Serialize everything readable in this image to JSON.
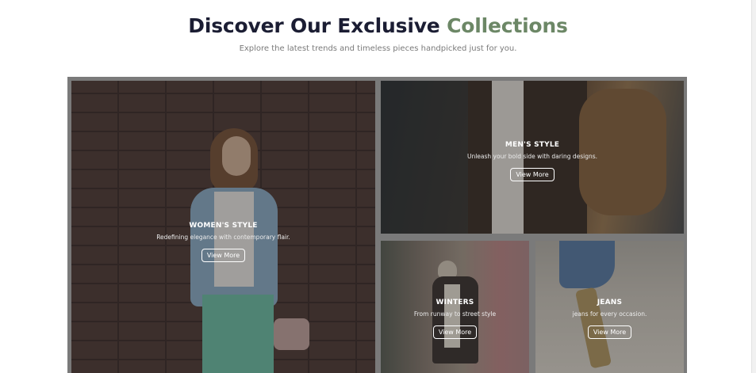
{
  "header": {
    "title_main": "Discover Our Exclusive",
    "title_accent": "Collections",
    "subtitle": "Explore the latest trends and timeless pieces handpicked just for you."
  },
  "collections": [
    {
      "title": "WOMEN'S STYLE",
      "description": "Redefining elegance with contemporary flair.",
      "button": "View More"
    },
    {
      "title": "MEN'S STYLE",
      "description": "Unleash your bold side with daring designs.",
      "button": "View More"
    },
    {
      "title": "WINTERS",
      "description": "From runway to street style",
      "button": "View More"
    },
    {
      "title": "JEANS",
      "description": "jeans for every occasion.",
      "button": "View More"
    }
  ],
  "colors": {
    "title": "#1b1d33",
    "accent": "#6c8766",
    "subtitle": "#7a7a7a"
  }
}
